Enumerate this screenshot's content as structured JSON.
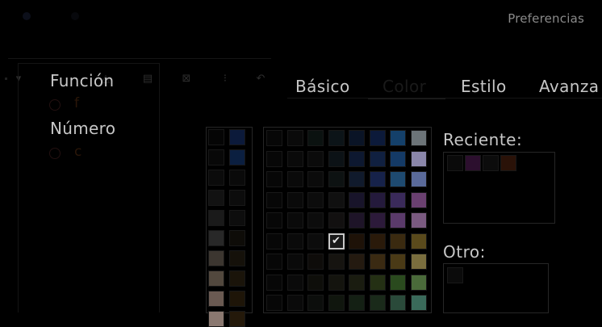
{
  "window": {
    "title": "Preferencias"
  },
  "toolbar": {
    "icons": [
      "chevron-down-icon",
      "grid-icon",
      "warning-icon",
      "table-icon",
      "select-icon",
      "info-icon",
      "undo-icon"
    ]
  },
  "sidebar": {
    "items": [
      {
        "label": "Función",
        "option": "f"
      },
      {
        "label": "Número",
        "option": "c"
      }
    ]
  },
  "tabs": [
    {
      "label": "Básico"
    },
    {
      "label": "Color",
      "active": true
    },
    {
      "label": "Estilo"
    },
    {
      "label": "Avanza"
    }
  ],
  "color": {
    "recent_label": "Reciente:",
    "other_label": "Otro:",
    "selected_indicator": "✔",
    "accent": "#1e5a8a"
  }
}
